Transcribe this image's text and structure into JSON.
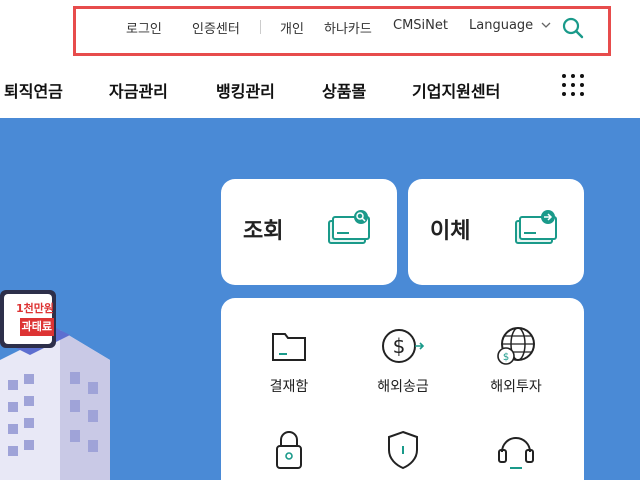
{
  "util_nav": {
    "items": [
      "로그인",
      "인증센터",
      "개인",
      "하나카드",
      "CMSiNet"
    ],
    "language": "Language"
  },
  "main_nav": {
    "items": [
      "퇴직연금",
      "자금관리",
      "뱅킹관리",
      "상품몰",
      "기업지원센터"
    ]
  },
  "quick": {
    "inquiry": "조회",
    "transfer": "이체"
  },
  "services": [
    {
      "label": "결재함",
      "icon": "folder-icon"
    },
    {
      "label": "해외송금",
      "icon": "dollar-transfer-icon"
    },
    {
      "label": "해외투자",
      "icon": "globe-dollar-icon"
    },
    {
      "label": "",
      "icon": "lock-icon"
    },
    {
      "label": "",
      "icon": "shield-icon"
    },
    {
      "label": "",
      "icon": "headset-icon"
    }
  ],
  "banner": {
    "line1": "1천만원",
    "line2": "과태료"
  },
  "colors": {
    "hero_bg": "#4a8ad6",
    "accent": "#1a9a8a",
    "highlight_box": "#e74c4c"
  }
}
